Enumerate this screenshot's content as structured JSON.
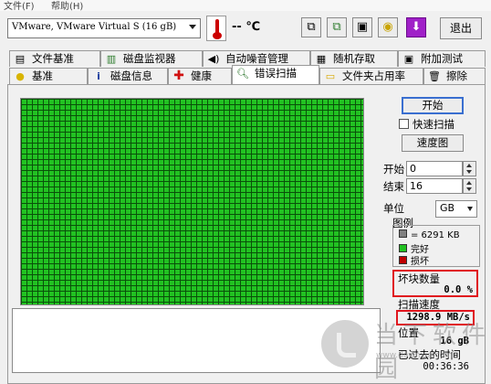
{
  "menu": {
    "items": [
      "文件(F)",
      "帮助(H)"
    ]
  },
  "toolbar": {
    "drive": "VMware, VMware Virtual S (16 gB)",
    "temperature": "--  ℃",
    "exit_label": "退出",
    "icons": [
      "copy-icon",
      "copy-alt-icon",
      "camera-icon",
      "save-disk-icon",
      "download-arrow-icon"
    ]
  },
  "tabs_top": [
    {
      "label": "文件基准",
      "icon": "document-icon"
    },
    {
      "label": "磁盘监视器",
      "icon": "monitor-icon"
    },
    {
      "label": "自动噪音管理",
      "icon": "speaker-icon"
    },
    {
      "label": "随机存取",
      "icon": "random-access-icon"
    },
    {
      "label": "附加测试",
      "icon": "extra-test-icon"
    }
  ],
  "tabs_bottom": [
    {
      "label": "基准",
      "icon": "bulb-icon"
    },
    {
      "label": "磁盘信息",
      "icon": "info-icon"
    },
    {
      "label": "健康",
      "icon": "health-cross-icon"
    },
    {
      "label": "错误扫描",
      "icon": "magnifier-icon",
      "active": true
    },
    {
      "label": "文件夹占用率",
      "icon": "folder-icon"
    },
    {
      "label": "擦除",
      "icon": "trash-icon"
    }
  ],
  "controls": {
    "start_button": "开始",
    "quick_scan": "快速扫描",
    "speed_map_button": "速度图",
    "start_label": "开始",
    "start_value": "0",
    "end_label": "结束",
    "end_value": "16",
    "unit_label": "单位",
    "unit_value": "GB"
  },
  "legend": {
    "title": "图例",
    "block_size": "= 6291 KB",
    "ok": "完好",
    "damaged": "损坏",
    "colors": {
      "block": "#808080",
      "ok": "#22c222",
      "damaged": "#c00000"
    }
  },
  "stats": {
    "bad_blocks_label": "坏块数量",
    "bad_blocks_value": "0.0 %",
    "scan_speed_label": "扫描速度",
    "scan_speed_value": "1298.9 MB/s",
    "position_label": "位置",
    "position_value": "16 gB",
    "elapsed_label": "已过去的时间",
    "elapsed_value": "00:36:36"
  },
  "watermark": {
    "text": "当下软件园",
    "url": "www.downxia.com"
  }
}
